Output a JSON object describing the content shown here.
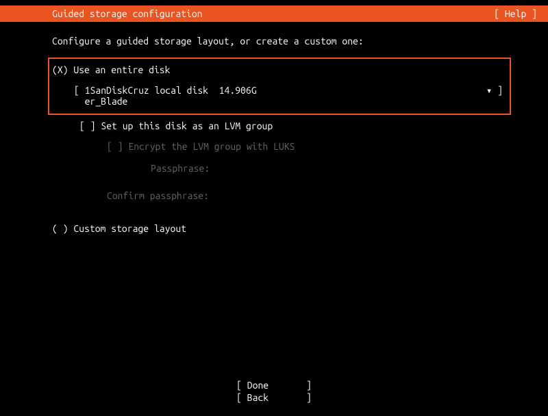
{
  "header": {
    "title": "Guided storage configuration",
    "help": "[ Help ]"
  },
  "subtitle": "Configure a guided storage layout, or create a custom one:",
  "option_entire_disk": {
    "radio": "(X)  Use an entire disk",
    "disk_left": "[ 1SanDiskCruz local disk  14.906G\n  er_Blade",
    "disk_right": "▾ ]"
  },
  "lvm_checkbox": "[ ]  Set up this disk as an LVM group",
  "encrypt": "[ ]  Encrypt the LVM group with LUKS",
  "passphrase_label": "Passphrase:",
  "confirm_label": "Confirm passphrase:",
  "option_custom": "( )  Custom storage layout",
  "footer": {
    "done": "[ Done       ]",
    "back": "[ Back       ]"
  }
}
